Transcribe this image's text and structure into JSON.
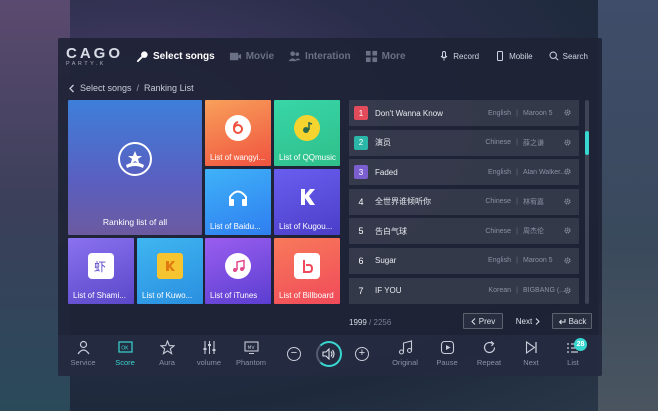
{
  "app": {
    "logo_main": "CAGO",
    "logo_sub": "PARTY.K"
  },
  "nav": {
    "items": [
      {
        "label": "Select songs",
        "icon": "mic-icon",
        "active": true
      },
      {
        "label": "Movie",
        "icon": "film-icon",
        "active": false
      },
      {
        "label": "Interation",
        "icon": "people-icon",
        "active": false
      },
      {
        "label": "More",
        "icon": "grid-icon",
        "active": false
      }
    ],
    "right": [
      {
        "label": "Record",
        "icon": "record-mic-icon"
      },
      {
        "label": "Mobile",
        "icon": "mobile-icon"
      },
      {
        "label": "Search",
        "icon": "search-icon"
      }
    ]
  },
  "breadcrumb": {
    "root": "Select songs",
    "separator": "/",
    "current": "Ranking List"
  },
  "tiles": [
    {
      "label": "Ranking list of all",
      "icon": "star-crown-icon",
      "color": "#3e7fd9"
    },
    {
      "label": "List of wangyi...",
      "icon": "netease-icon",
      "color": "#f0523f"
    },
    {
      "label": "List of QQmusic",
      "icon": "qqmusic-icon",
      "color": "#2fbf8a"
    },
    {
      "label": "List of Baidu...",
      "icon": "headphones-icon",
      "color": "#2f8ef0"
    },
    {
      "label": "List of Kugou...",
      "icon": "kugou-icon",
      "color": "#5a4ed8"
    },
    {
      "label": "List of Shami...",
      "icon": "shrimp-icon",
      "color": "#6a58d6"
    },
    {
      "label": "List of Kuwo...",
      "icon": "kuwo-icon",
      "color": "#2aa9e8"
    },
    {
      "label": "List of iTunes",
      "icon": "music-note-icon",
      "color": "#7a4ce0"
    },
    {
      "label": "List of Billboard",
      "icon": "billboard-icon",
      "color": "#f05a4c"
    }
  ],
  "songs": [
    {
      "rank": "1",
      "title": "Don't Wanna Know",
      "lang": "English",
      "artist": "Maroon 5"
    },
    {
      "rank": "2",
      "title": "演员",
      "lang": "Chinese",
      "artist": "薛之谦"
    },
    {
      "rank": "3",
      "title": "Faded",
      "lang": "English",
      "artist": "Alan Walker..."
    },
    {
      "rank": "4",
      "title": "全世界谁倾听你",
      "lang": "Chinese",
      "artist": "林宥嘉"
    },
    {
      "rank": "5",
      "title": "告白气球",
      "lang": "Chinese",
      "artist": "周杰伦"
    },
    {
      "rank": "6",
      "title": "Sugar",
      "lang": "English",
      "artist": "Maroon 5"
    },
    {
      "rank": "7",
      "title": "IF YOU",
      "lang": "Korean",
      "artist": "BIGBANG (..."
    }
  ],
  "song_separator": "|",
  "rank_colors": [
    "#e24b5a",
    "#2bb7a8",
    "#7b5fd0"
  ],
  "pager": {
    "current": "1999",
    "separator": "/",
    "total": "2256",
    "prev": "Prev",
    "next": "Next",
    "back": "Back"
  },
  "bottom": {
    "left": [
      {
        "label": "Service",
        "icon": "person-icon",
        "active": false
      },
      {
        "label": "Score",
        "icon": "score-icon",
        "active": true
      },
      {
        "label": "Aura",
        "icon": "star-outline-icon",
        "active": false
      },
      {
        "label": "volume",
        "icon": "sliders-icon",
        "active": false
      },
      {
        "label": "Phantom",
        "icon": "mv-icon",
        "active": false
      }
    ],
    "right": [
      {
        "label": "Original",
        "icon": "music-notes-icon"
      },
      {
        "label": "Pause",
        "icon": "pause-icon"
      },
      {
        "label": "Repeat",
        "icon": "repeat-icon"
      },
      {
        "label": "Next",
        "icon": "skip-next-icon"
      },
      {
        "label": "List",
        "icon": "list-icon"
      }
    ],
    "score_badge": "OK",
    "mv_badge": "MV",
    "list_count": "28",
    "vol_minus": "−",
    "vol_plus": "+"
  },
  "accent": "#38d6d0"
}
